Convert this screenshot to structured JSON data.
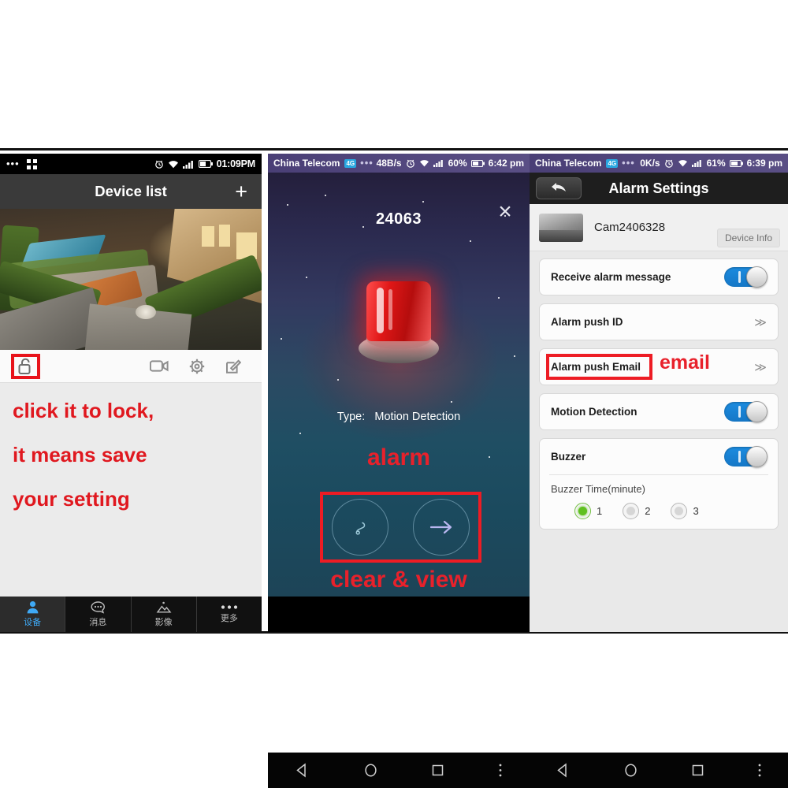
{
  "phone1": {
    "status": {
      "dots_icon": "more-dots",
      "grid_icon": "qr-grid",
      "alarm_icon": "alarm-clock",
      "wifi_icon": "wifi",
      "signal_icon": "signal-bars",
      "battery_icon": "battery",
      "time": "01:09PM"
    },
    "titlebar": {
      "title": "Device list",
      "add_label": "+"
    },
    "camera_preview": {
      "alt": "outdoor courtyard camera snapshot"
    },
    "toolbar": {
      "lock_icon": "unlock-icon",
      "video_icon": "video-camera-icon",
      "settings_icon": "gear-icon",
      "edit_icon": "edit-pencil-icon"
    },
    "annotation": {
      "line1": "click it to lock,",
      "line2": "it means save",
      "line3": "your setting",
      "color": "#e0181f"
    },
    "tabs": [
      {
        "label": "设备",
        "icon": "person-icon",
        "active": true
      },
      {
        "label": "消息",
        "icon": "chat-bubble-icon",
        "active": false
      },
      {
        "label": "影像",
        "icon": "image-icon",
        "active": false
      },
      {
        "label": "更多",
        "icon": "more-dots-icon",
        "active": false
      }
    ]
  },
  "phone2": {
    "status": {
      "carrier": "China Telecom",
      "net_badge": "4G",
      "dots_icon": "more-dots",
      "speed": "48B/s",
      "alarm_icon": "alarm-clock",
      "wifi_icon": "wifi",
      "signal_icon": "signal-bars",
      "battery_pct": "60%",
      "battery_icon": "battery",
      "time": "6:42 pm"
    },
    "alarm": {
      "number": "24063",
      "close_icon": "close-x-icon",
      "siren_icon": "siren-light-icon",
      "type_label": "Type:",
      "type_value": "Motion Detection"
    },
    "annotations": {
      "alarm_note": "alarm",
      "actions_note": "clear & view",
      "color": "#e8212b"
    },
    "actions": [
      {
        "name": "clear-button",
        "icon": "clear-icon"
      },
      {
        "name": "view-button",
        "icon": "arrow-right-icon"
      }
    ],
    "navbar": {
      "back_icon": "back-triangle-icon",
      "home_icon": "home-circle-icon",
      "recents_icon": "recents-square-icon",
      "menu_icon": "vertical-dots-icon"
    }
  },
  "phone3": {
    "status": {
      "carrier": "China Telecom",
      "net_badge": "4G",
      "dots_icon": "more-dots",
      "speed": "0K/s",
      "alarm_icon": "alarm-clock",
      "wifi_icon": "wifi",
      "signal_icon": "signal-bars",
      "battery_pct": "61%",
      "battery_icon": "battery",
      "time": "6:39 pm"
    },
    "titlebar": {
      "title": "Alarm Settings",
      "back_icon": "back-arrow-icon"
    },
    "device": {
      "name": "Cam2406328",
      "info_button": "Device Info",
      "thumb_icon": "camera-thumbnail"
    },
    "settings": [
      {
        "label": "Receive alarm message",
        "control": "toggle",
        "state": "on"
      },
      {
        "label": "Alarm push ID",
        "control": "chevron",
        "chevron": "≫"
      },
      {
        "label": "Alarm push Email",
        "control": "chevron",
        "chevron": "≫",
        "highlighted": true
      },
      {
        "label": "Motion Detection",
        "control": "toggle",
        "state": "on"
      },
      {
        "label": "Buzzer",
        "control": "toggle",
        "state": "on"
      }
    ],
    "buzzer_time": {
      "label": "Buzzer Time(minute)",
      "options": [
        "1",
        "2",
        "3"
      ],
      "selected": "1"
    },
    "annotations": {
      "email_note": "email",
      "color": "#e8212b"
    },
    "navbar": {
      "back_icon": "back-triangle-icon",
      "home_icon": "home-circle-icon",
      "recents_icon": "recents-square-icon",
      "menu_icon": "vertical-dots-icon"
    }
  }
}
